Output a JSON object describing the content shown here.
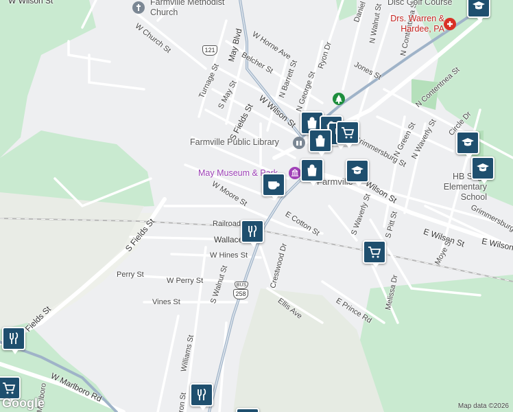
{
  "places": {
    "methodist_church": "Farmville Methodist Church",
    "library": "Farmville Public Library",
    "museum": "May Museum & Park",
    "drs": "Drs. Warren & Hardee, PA",
    "disc_golf": "Disc Golf Course",
    "school": "HB Sugg Elementary School",
    "town": "Farmville"
  },
  "streets": {
    "w_wilson_top": "W Wilson St",
    "w_church": "W Church St",
    "w_horne": "W Horne Ave",
    "may_blvd": "May Blvd",
    "turnage": "Turnage St",
    "belcher": "Belcher St",
    "s_may": "S May St",
    "n_barrett": "N Barrett St",
    "n_george": "N George St",
    "ryon": "Ryon Dr",
    "daniel": "Daniel St",
    "n_walnut": "N Walnut St",
    "jones": "Jones St",
    "n_contentnea_1": "N Contentnea St",
    "n_contentnea_2": "N Contentnea St",
    "s_fields_1": "S Fields St",
    "w_wilson": "W Wilson St",
    "n_green": "N Green St",
    "grimmersburg": "Grimmersburg St",
    "n_waverly": "N Waverly St",
    "circle": "Circle Dr",
    "w_moore": "W Moore St",
    "wilson": "Wilson St",
    "grimmersburg_2": "Grimmersburg St",
    "railroad": "Railroad",
    "e_cotton": "E Cotton St",
    "s_waverly": "S Waverly St",
    "s_pitt": "S Pitt St",
    "e_wilson": "E Wilson St",
    "e_wilson_2": "E Wilson",
    "s_fields_2": "S Fields St",
    "wallace": "Wallace",
    "w_hines": "W Hines St",
    "crestwood": "Crestwood Dr",
    "moye": "Moye St",
    "perry": "Perry St",
    "w_perry": "W Perry St",
    "s_walnut": "S Walnut St",
    "melissa": "Melissa Dr",
    "vines": "Vines St",
    "ellis": "Ellis Ave",
    "e_prince": "E Prince Rd",
    "fields_sw": "Fields St",
    "williams": "Williams St",
    "w_marlboro": "W Marlboro Rd",
    "marlboro_2": "Marlboro",
    "ron": "ron St"
  },
  "shields": {
    "nc121": "121",
    "bus": "BUS",
    "us258": "258"
  },
  "attribution": "Map data ©2026",
  "logo": "Google",
  "colors": {
    "pin": "#1f4f6e",
    "park": "#c4e8c7",
    "road": "#ffffff",
    "highway": "#8fa4bd",
    "poi_purple": "#9b3fb5",
    "poi_red": "#c5221f"
  },
  "pins": [
    "restaurant-pin",
    "shopping-pin",
    "cafe-pin",
    "school-pin",
    "grocery-pin"
  ]
}
